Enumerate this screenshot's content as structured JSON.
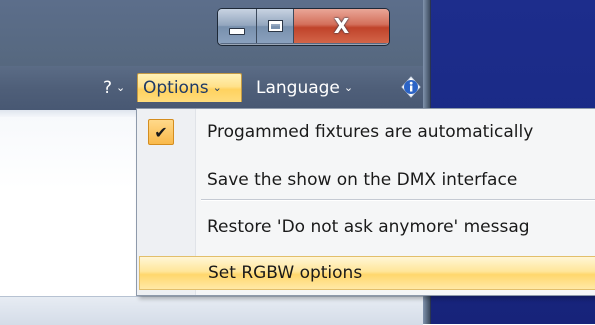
{
  "window": {
    "title_buttons": {
      "minimize_icon": "minimize-icon",
      "maximize_icon": "maximize-icon",
      "close_glyph": "X"
    }
  },
  "menubar": {
    "help_label": "?",
    "options_label": "Options",
    "language_label": "Language",
    "chevron": "⌄",
    "info_icon": "info-icon"
  },
  "options_menu": {
    "items": [
      {
        "label": "Progammed fixtures are automatically",
        "checked": true
      },
      {
        "label": "Save the show on the DMX interface",
        "checked": false
      },
      {
        "label": "Restore 'Do not ask anymore' messag",
        "checked": false
      },
      {
        "label": "Set RGBW options",
        "checked": false,
        "highlighted": true
      }
    ],
    "check_glyph": "✔"
  },
  "colors": {
    "menu_highlight": "#ffdc7c",
    "desktop_blue": "#1a2a86",
    "frame": "#56687f",
    "close_red": "#c0432b"
  }
}
